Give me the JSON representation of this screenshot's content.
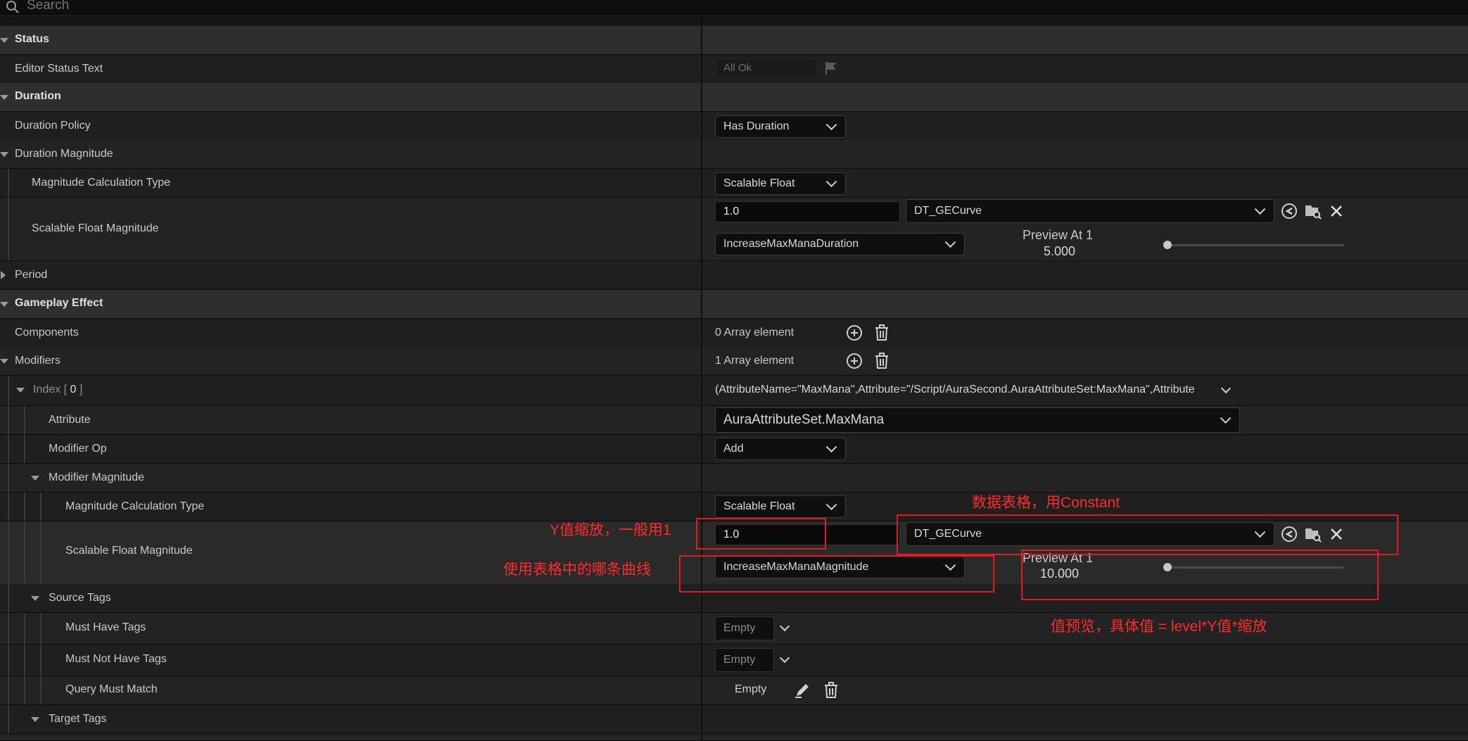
{
  "search": {
    "placeholder": "Search"
  },
  "sections": {
    "status": "Status",
    "duration": "Duration",
    "period": "Period",
    "gameplay_effect": "Gameplay Effect"
  },
  "props": {
    "editor_status_text": "Editor Status Text",
    "duration_policy": "Duration Policy",
    "duration_magnitude": "Duration Magnitude",
    "magnitude_calc_type": "Magnitude Calculation Type",
    "scalable_float_magnitude": "Scalable Float Magnitude",
    "components": "Components",
    "modifiers": "Modifiers",
    "index_label": "Index",
    "index_value": "0",
    "attribute": "Attribute",
    "modifier_op": "Modifier Op",
    "modifier_magnitude": "Modifier Magnitude",
    "magnitude_calc_type_2": "Magnitude Calculation Type",
    "scalable_float_magnitude_2": "Scalable Float Magnitude",
    "source_tags": "Source Tags",
    "must_have_tags": "Must Have Tags",
    "must_not_have_tags": "Must Not Have Tags",
    "query_must_match": "Query Must Match",
    "target_tags": "Target Tags"
  },
  "values": {
    "editor_status": "All Ok",
    "duration_policy": "Has Duration",
    "duration_calc_type": "Scalable Float",
    "duration_float": "1.0",
    "duration_table": "DT_GECurve",
    "duration_row": "IncreaseMaxManaDuration",
    "duration_preview_title": "Preview At 1",
    "duration_preview_value": "5.000",
    "duration_slider_level": 0,
    "components_count": "0 Array element",
    "modifiers_count": "1 Array element",
    "index_summary": "(AttributeName=\"MaxMana\",Attribute=\"/Script/AuraSecond.AuraAttributeSet:MaxMana\",Attribute",
    "attribute": "AuraAttributeSet.MaxMana",
    "modifier_op": "Add",
    "mod_calc_type": "Scalable Float",
    "mod_float": "1.0",
    "mod_table": "DT_GECurve",
    "mod_row": "IncreaseMaxManaMagnitude",
    "mod_preview_title": "Preview At 1",
    "mod_preview_value": "10.000",
    "mod_slider_level": 0,
    "must_have_tags": "Empty",
    "must_not_have_tags": "Empty",
    "query_must_match": "Empty"
  },
  "annotations": {
    "y_scale": "Y值缩放，一般用1",
    "data_table": "数据表格，用Constant",
    "curve_row": "使用表格中的哪条曲线",
    "preview": "值预览，具体值 = level*Y值*缩放"
  },
  "colors": {
    "annotation": "#ff2a2a",
    "background": "#151515"
  }
}
